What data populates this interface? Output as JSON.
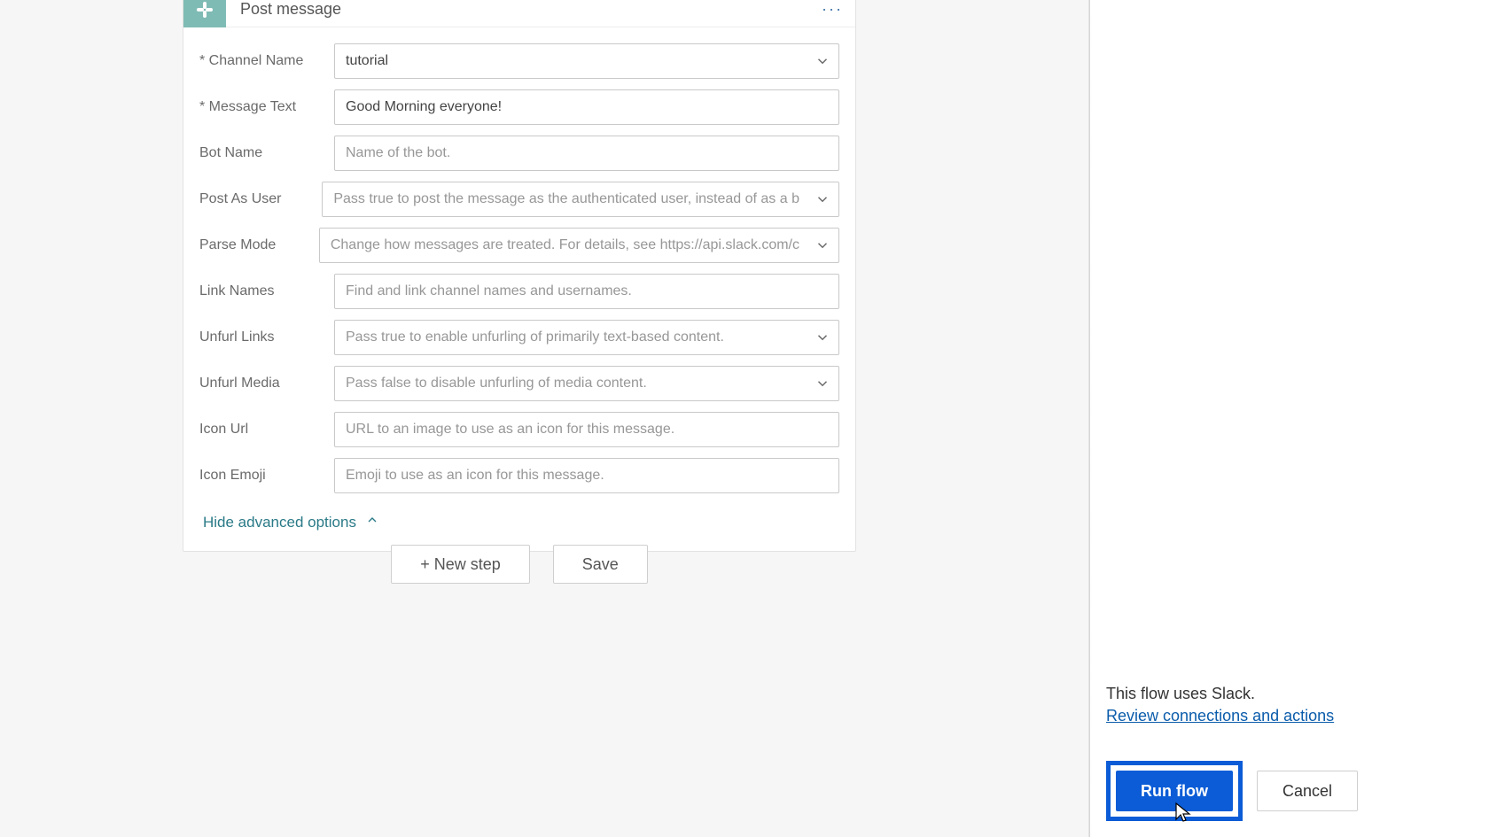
{
  "card": {
    "title": "Post message",
    "menu_label": "···",
    "advanced_toggle": "Hide advanced options"
  },
  "fields": {
    "channel_name": {
      "label": "Channel Name",
      "required": true,
      "type": "select",
      "value": "tutorial",
      "placeholder": ""
    },
    "message_text": {
      "label": "Message Text",
      "required": true,
      "type": "text",
      "value": "Good Morning everyone!",
      "placeholder": ""
    },
    "bot_name": {
      "label": "Bot Name",
      "required": false,
      "type": "text",
      "value": "",
      "placeholder": "Name of the bot."
    },
    "post_as_user": {
      "label": "Post As User",
      "required": false,
      "type": "select",
      "value": "",
      "placeholder": "Pass true to post the message as the authenticated user, instead of as a b"
    },
    "parse_mode": {
      "label": "Parse Mode",
      "required": false,
      "type": "select",
      "value": "",
      "placeholder": "Change how messages are treated. For details, see https://api.slack.com/c"
    },
    "link_names": {
      "label": "Link Names",
      "required": false,
      "type": "text",
      "value": "",
      "placeholder": "Find and link channel names and usernames."
    },
    "unfurl_links": {
      "label": "Unfurl Links",
      "required": false,
      "type": "select",
      "value": "",
      "placeholder": "Pass true to enable unfurling of primarily text-based content."
    },
    "unfurl_media": {
      "label": "Unfurl Media",
      "required": false,
      "type": "select",
      "value": "",
      "placeholder": "Pass false to disable unfurling of media content."
    },
    "icon_url": {
      "label": "Icon Url",
      "required": false,
      "type": "text",
      "value": "",
      "placeholder": "URL to an image to use as an icon for this message."
    },
    "icon_emoji": {
      "label": "Icon Emoji",
      "required": false,
      "type": "text",
      "value": "",
      "placeholder": "Emoji to use as an icon for this message."
    }
  },
  "actions": {
    "new_step": "+ New step",
    "save": "Save"
  },
  "panel": {
    "message": "This flow uses Slack.",
    "review_link": "Review connections and actions",
    "run_flow": "Run flow",
    "cancel": "Cancel"
  },
  "colors": {
    "accent": "#0b5cd6",
    "header_icon_bg": "#7fbbb5",
    "link": "#0b5cab",
    "adv_link": "#2a7a87"
  }
}
